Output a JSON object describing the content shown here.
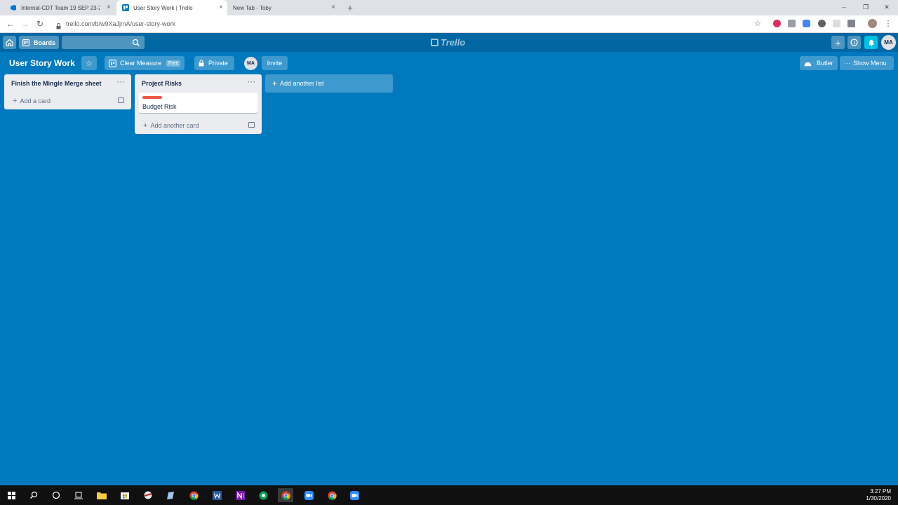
{
  "browser": {
    "tabs": [
      {
        "title": "Internal-CDT Team 19 SEP 23-27",
        "close": "×",
        "active": false
      },
      {
        "title": "User Story Work | Trello",
        "close": "×",
        "active": true
      },
      {
        "title": "New Tab - Toby",
        "close": "×",
        "active": false
      }
    ],
    "new_tab": "+",
    "url": "trello.com/b/w9XaJjmA/user-story-work",
    "window_controls": {
      "minimize": "–",
      "restore": "❐",
      "close": "✕"
    }
  },
  "header": {
    "boards_label": "Boards",
    "logo_text": "Trello",
    "avatar_initials": "MA"
  },
  "board": {
    "title": "User Story Work",
    "team_name": "Clear Measure",
    "team_badge": "Free",
    "visibility": "Private",
    "member_initials": "MA",
    "invite_label": "Invite",
    "butler_label": "Butler",
    "show_menu_label": "Show Menu"
  },
  "lists": [
    {
      "title": "Finish the Mingle Merge sheet",
      "menu": "···",
      "cards": [],
      "add_label": "Add a card"
    },
    {
      "title": "Project Risks",
      "menu": "···",
      "cards": [
        {
          "title": "Budget Risk",
          "label_color": "#eb5a46"
        }
      ],
      "add_label": "Add another card"
    }
  ],
  "add_list_label": "Add another list",
  "taskbar": {
    "time": "3:27 PM",
    "date": "1/30/2020"
  },
  "colors": {
    "board_bg": "#0079bf",
    "header_bg": "#0067a3",
    "label_red": "#eb5a46"
  }
}
